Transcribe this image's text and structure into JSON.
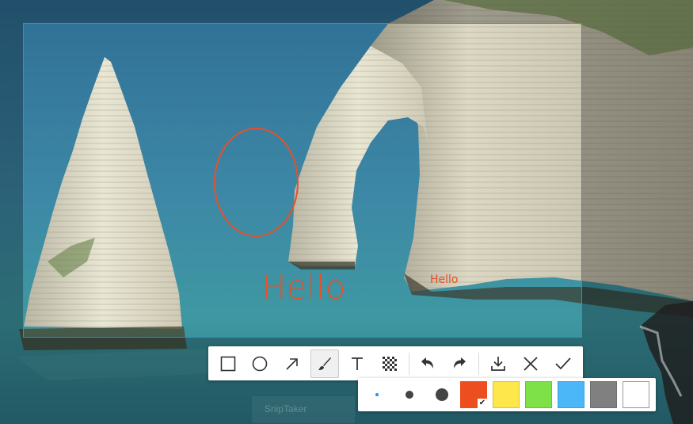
{
  "annotations": {
    "big_text": "Hello",
    "small_text": "Hello",
    "color": "#e8502a"
  },
  "selection": {
    "border_color": "#1e90ff"
  },
  "toolbar": {
    "tools": [
      {
        "name": "rectangle-tool",
        "icon": "square-icon"
      },
      {
        "name": "ellipse-tool",
        "icon": "circle-icon"
      },
      {
        "name": "arrow-tool",
        "icon": "arrow-up-right-icon"
      },
      {
        "name": "brush-tool",
        "icon": "brush-icon",
        "active": true
      },
      {
        "name": "text-tool",
        "icon": "text-icon"
      },
      {
        "name": "mosaic-tool",
        "icon": "mosaic-icon"
      }
    ],
    "history": [
      {
        "name": "undo-button",
        "icon": "undo-icon"
      },
      {
        "name": "redo-button",
        "icon": "redo-icon"
      }
    ],
    "actions": [
      {
        "name": "save-button",
        "icon": "download-icon"
      },
      {
        "name": "cancel-button",
        "icon": "close-icon"
      },
      {
        "name": "confirm-button",
        "icon": "check-icon"
      }
    ]
  },
  "options": {
    "stroke_sizes": [
      "small",
      "medium",
      "large"
    ],
    "selected_size": "small",
    "colors": [
      "#ec4e1f",
      "#fde74a",
      "#7ee147",
      "#4cb7f8",
      "#808080",
      "#ffffff"
    ],
    "selected_color": "#ec4e1f"
  },
  "watermark": {
    "text": "SnipTaker"
  }
}
